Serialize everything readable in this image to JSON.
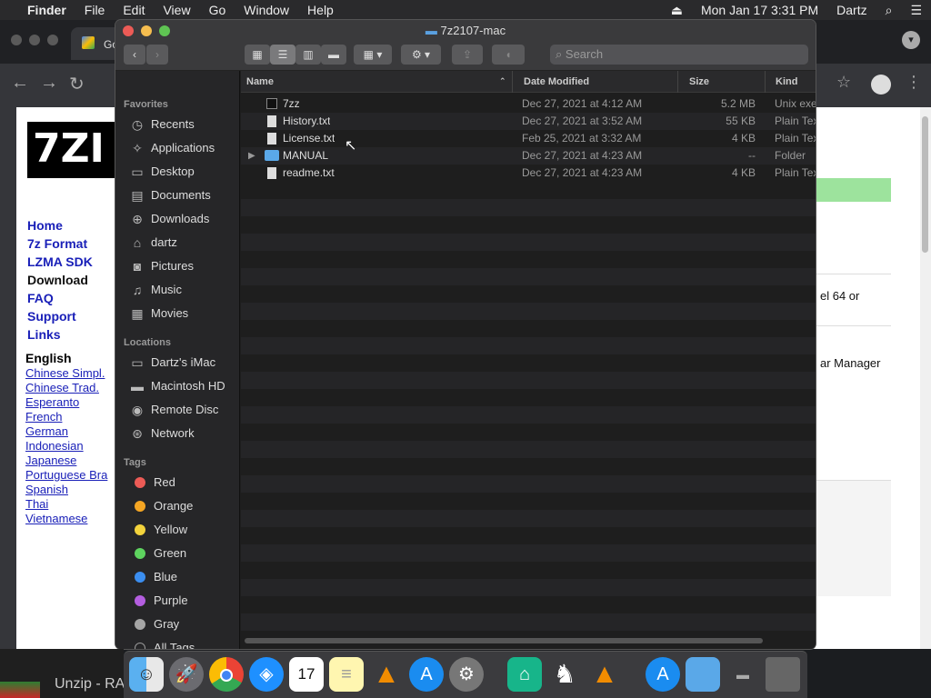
{
  "menubar": {
    "apple_icon": "apple-icon",
    "app": "Finder",
    "items": [
      "File",
      "Edit",
      "View",
      "Go",
      "Window",
      "Help"
    ],
    "datetime": "Mon Jan 17  3:31 PM",
    "user": "Dartz"
  },
  "browser": {
    "tab_label": "Go",
    "bottom_tab": "Unzip - RA",
    "page": {
      "logo": "7ZI",
      "nav": [
        "Home",
        "7z Format",
        "LZMA SDK",
        "Download",
        "FAQ",
        "Support",
        "Links"
      ],
      "languages_heading": "English",
      "languages": [
        "Chinese Simpl.",
        "Chinese Trad.",
        "Esperanto",
        "French",
        "German",
        "Indonesian",
        "Japanese",
        "Portuguese Bra",
        "Spanish",
        "Thai",
        "Vietnamese"
      ],
      "right_text_1": "el 64 or",
      "right_text_2": "ar Manager"
    }
  },
  "finder": {
    "title": "7z2107-mac",
    "search_placeholder": "Search",
    "sidebar": {
      "favorites_heading": "Favorites",
      "favorites": [
        {
          "label": "Recents",
          "icon": "clock-icon"
        },
        {
          "label": "Applications",
          "icon": "applications-icon"
        },
        {
          "label": "Desktop",
          "icon": "desktop-icon"
        },
        {
          "label": "Documents",
          "icon": "document-icon"
        },
        {
          "label": "Downloads",
          "icon": "download-icon"
        },
        {
          "label": "dartz",
          "icon": "home-icon"
        },
        {
          "label": "Pictures",
          "icon": "camera-icon"
        },
        {
          "label": "Music",
          "icon": "music-icon"
        },
        {
          "label": "Movies",
          "icon": "film-icon"
        }
      ],
      "locations_heading": "Locations",
      "locations": [
        {
          "label": "Dartz's iMac",
          "icon": "imac-icon"
        },
        {
          "label": "Macintosh HD",
          "icon": "disk-icon"
        },
        {
          "label": "Remote Disc",
          "icon": "disc-icon"
        },
        {
          "label": "Network",
          "icon": "globe-icon"
        }
      ],
      "tags_heading": "Tags",
      "tags": [
        {
          "label": "Red",
          "color": "#ec5b56"
        },
        {
          "label": "Orange",
          "color": "#f5a623"
        },
        {
          "label": "Yellow",
          "color": "#f3d33c"
        },
        {
          "label": "Green",
          "color": "#5ed35f"
        },
        {
          "label": "Blue",
          "color": "#3b8ef0"
        },
        {
          "label": "Purple",
          "color": "#b45ee0"
        },
        {
          "label": "Gray",
          "color": "#a5a5a5"
        }
      ],
      "all_tags": "All Tags..."
    },
    "columns": {
      "name": "Name",
      "date": "Date Modified",
      "size": "Size",
      "kind": "Kind"
    },
    "files": [
      {
        "name": "7zz",
        "date": "Dec 27, 2021 at 4:12 AM",
        "size": "5.2 MB",
        "kind": "Unix exe"
      },
      {
        "name": "History.txt",
        "date": "Dec 27, 2021 at 3:52 AM",
        "size": "55 KB",
        "kind": "Plain Tex"
      },
      {
        "name": "License.txt",
        "date": "Feb 25, 2021 at 3:32 AM",
        "size": "4 KB",
        "kind": "Plain Tex"
      },
      {
        "name": "MANUAL",
        "date": "Dec 27, 2021 at 4:23 AM",
        "size": "--",
        "kind": "Folder"
      },
      {
        "name": "readme.txt",
        "date": "Dec 27, 2021 at 4:23 AM",
        "size": "4 KB",
        "kind": "Plain Tex"
      }
    ]
  },
  "dock": [
    "finder-icon",
    "launchpad-icon",
    "chrome-icon",
    "safari-icon",
    "calendar-icon",
    "notes-icon",
    "vlc-icon",
    "app-store-icon",
    "system-preferences-icon",
    "unarchiver-icon",
    "chess-icon",
    "vlc-icon",
    "app-store-icon",
    "folder-icon",
    "drive-icon",
    "trash-icon"
  ],
  "dock_calendar_day": "17"
}
